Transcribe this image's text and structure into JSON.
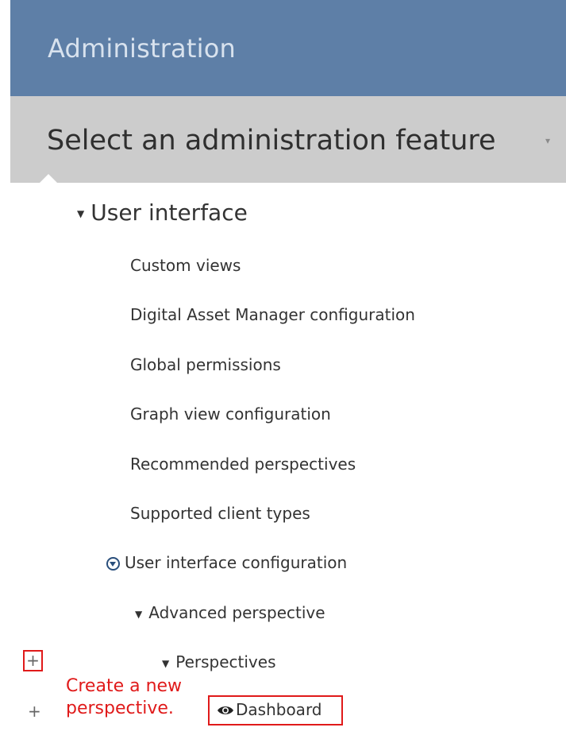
{
  "header": {
    "title": "Administration"
  },
  "feature_select": {
    "label": "Select an administration feature",
    "chevron": "▾"
  },
  "tree": {
    "root": {
      "label": "User interface",
      "caret": "▼"
    },
    "items": [
      "Custom views",
      "Digital Asset Manager configuration",
      "Global permissions",
      "Graph view configuration",
      "Recommended perspectives",
      "Supported client types"
    ],
    "ui_config": {
      "label": "User interface configuration"
    },
    "advanced": {
      "label": "Advanced perspective",
      "caret": "▼"
    },
    "perspectives": {
      "label": "Perspectives",
      "caret": "▼"
    },
    "dashboard": {
      "label": "Dashboard"
    }
  },
  "actions": {
    "plus_symbol": "+"
  },
  "annotation": {
    "line1": "Create a new",
    "line2": "perspective."
  },
  "colors": {
    "header_bg": "#5e7fa7",
    "feature_bg": "#cccccc",
    "highlight": "#e01a1a"
  }
}
